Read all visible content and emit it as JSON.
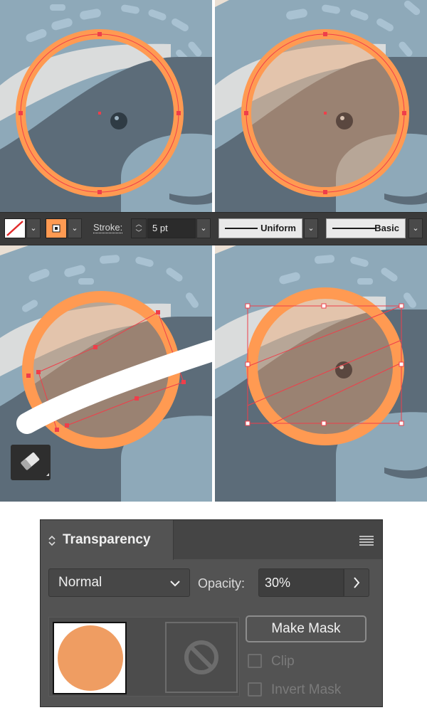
{
  "toolbar": {
    "fill_swatch": "none",
    "stroke_swatch_color": "#ff9a52",
    "stroke_label": "Stroke:",
    "stroke_weight": "5 pt",
    "variable_width_profile": "Uniform",
    "brush_definition": "Basic"
  },
  "transparency_panel": {
    "title": "Transparency",
    "blend_mode": "Normal",
    "opacity_label": "Opacity:",
    "opacity_value": "30%",
    "make_mask_label": "Make Mask",
    "clip_label": "Clip",
    "invert_mask_label": "Invert Mask",
    "object_thumbnail_color": "#ef9d62"
  },
  "colors": {
    "orange_ring": "#ff9a52",
    "anchor_red": "#ef3e4a",
    "bg_blue": "#8ea9b9",
    "dark_slate": "#5c6c79"
  },
  "icons": [
    "none-swatch-icon",
    "stroke-square-icon",
    "eraser-tool-icon",
    "panel-menu-icon",
    "collapse-arrows-icon",
    "no-mask-icon"
  ]
}
